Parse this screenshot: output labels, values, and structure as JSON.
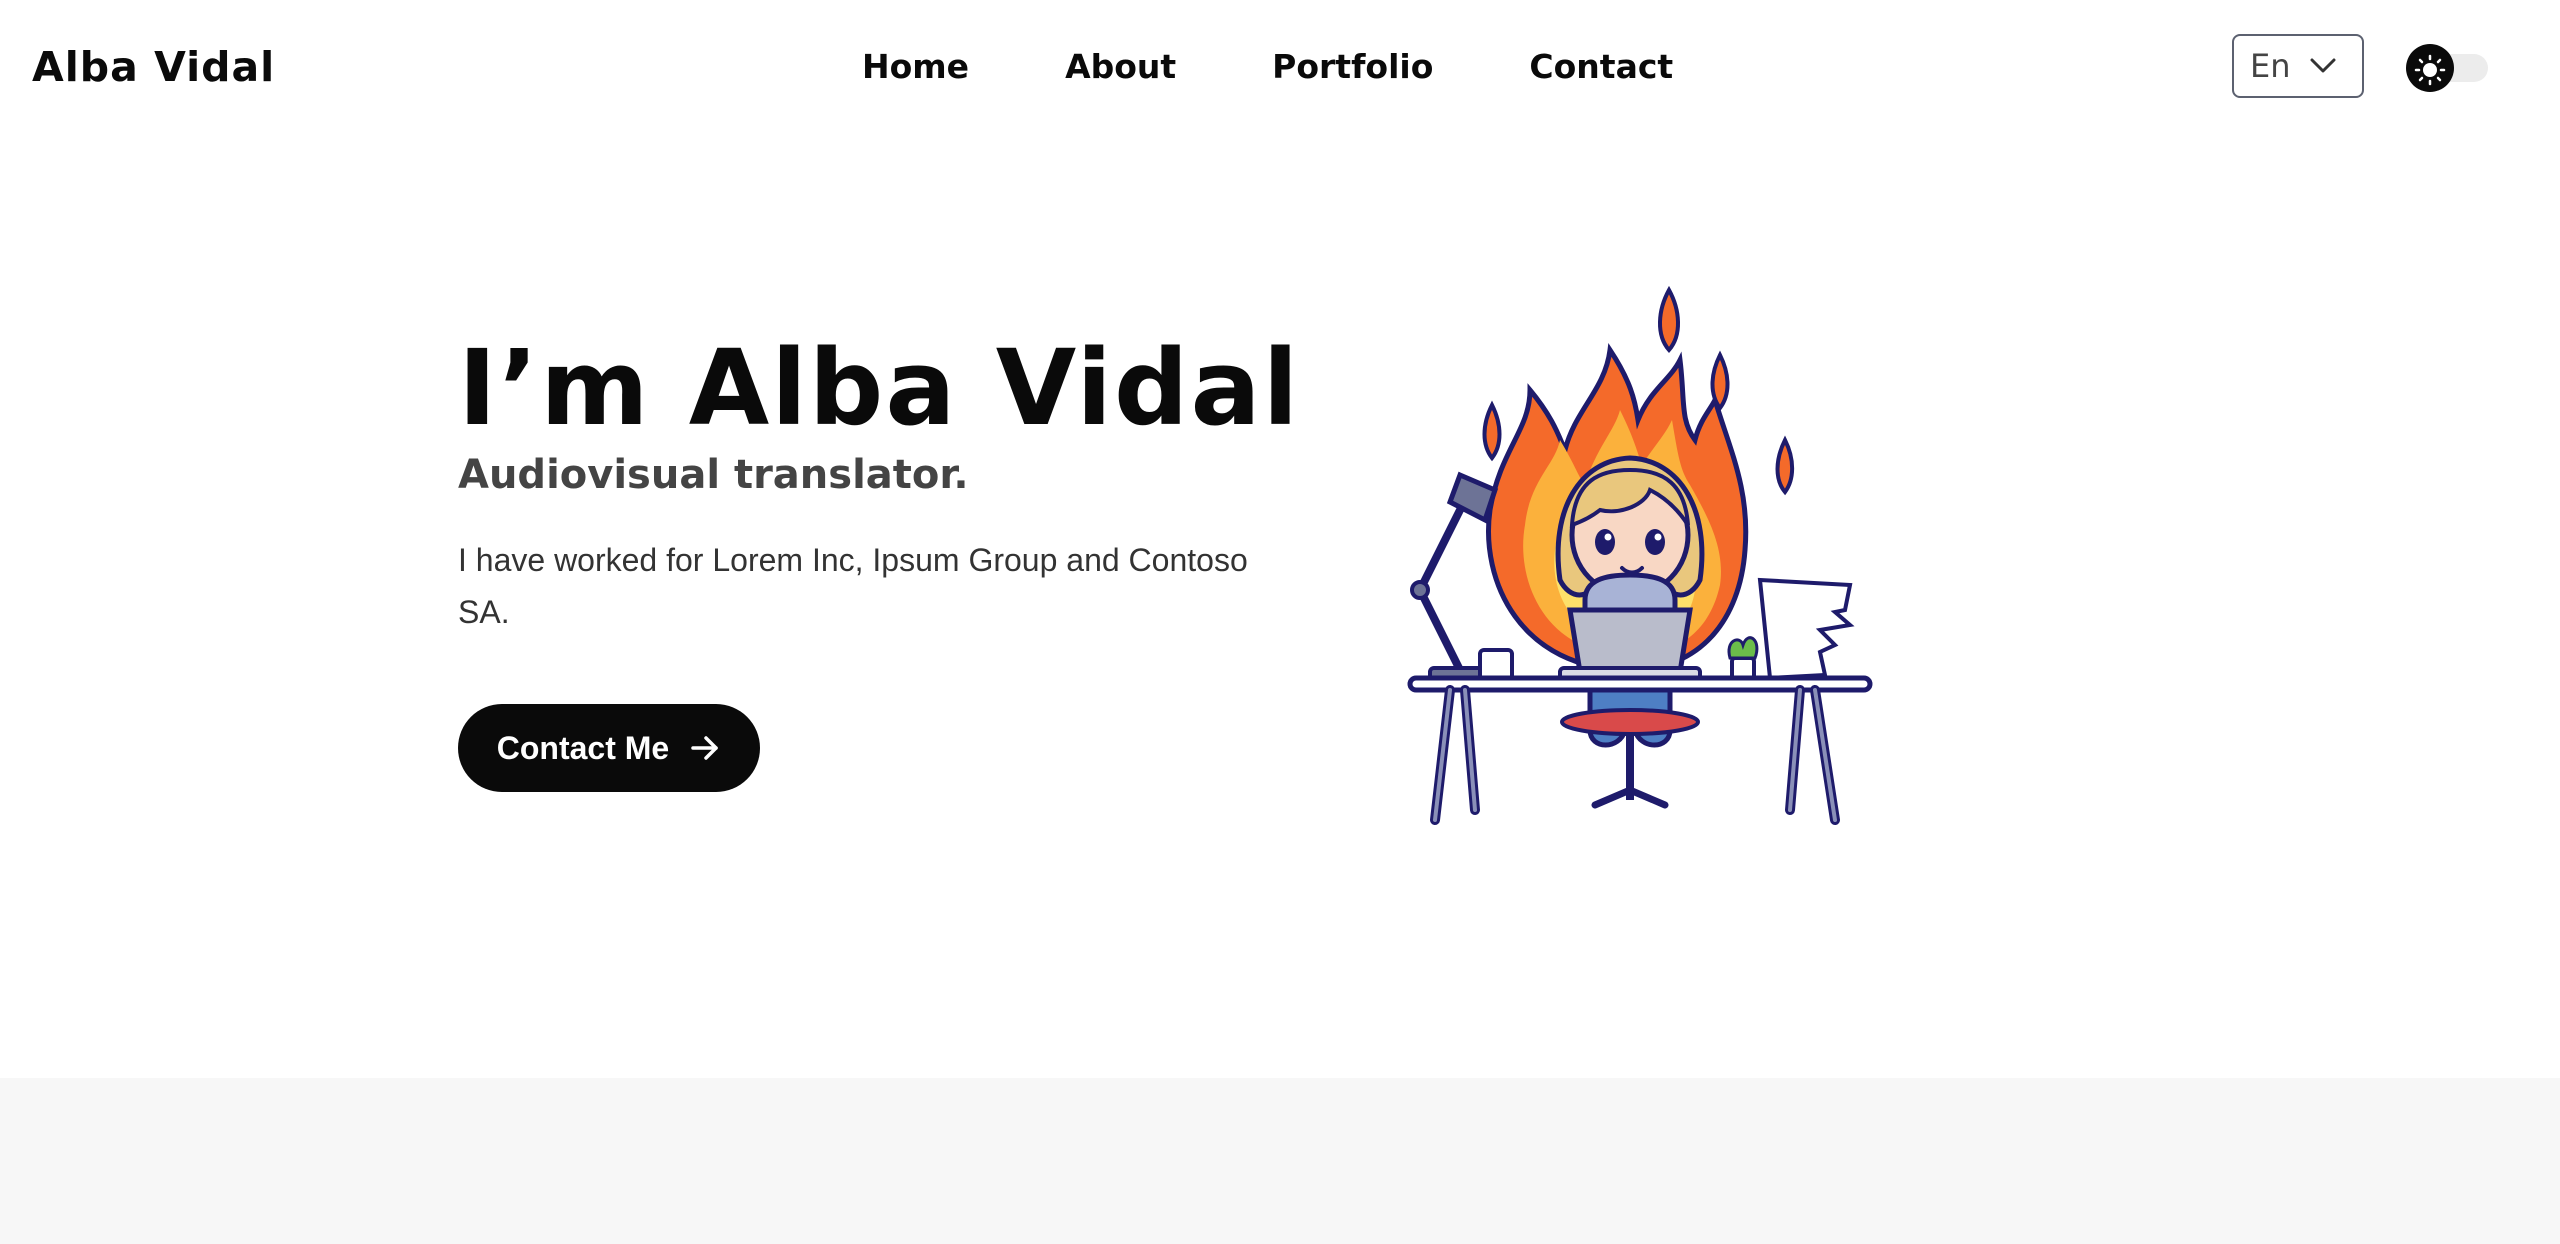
{
  "header": {
    "brand": "Alba Vidal",
    "nav": [
      {
        "label": "Home"
      },
      {
        "label": "About"
      },
      {
        "label": "Portfolio"
      },
      {
        "label": "Contact"
      }
    ],
    "language": {
      "selected": "En"
    },
    "theme_toggle": {
      "mode": "light",
      "icon": "sun-icon"
    }
  },
  "hero": {
    "title": "I’m Alba Vidal",
    "subtitle": "Audiovisual translator.",
    "description": "I have worked for Lorem Inc, Ipsum Group and Contoso SA.",
    "cta_label": "Contact Me",
    "cta_icon": "arrow-right-icon",
    "illustration": "girl-at-laptop-on-fire-illustration"
  },
  "colors": {
    "text": "#0a0a0a",
    "button_bg": "#0a0a0a",
    "button_text": "#ffffff",
    "subtitle": "#444444",
    "section_bg": "#f7f7f7"
  }
}
